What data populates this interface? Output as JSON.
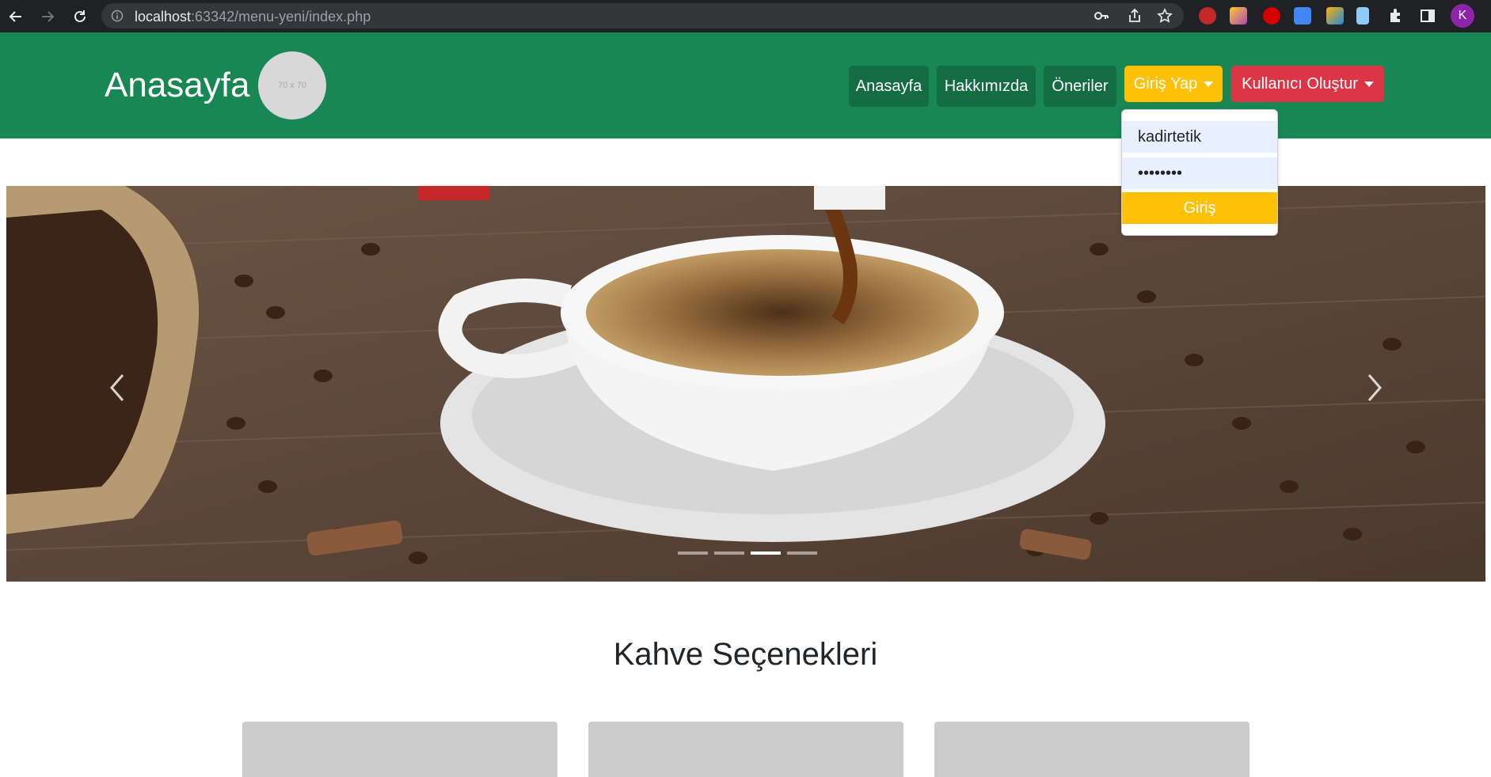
{
  "browser": {
    "url_host": "localhost",
    "url_path": ":63342/menu-yeni/index.php",
    "profile_initial": "K"
  },
  "header": {
    "brand": "Anasayfa",
    "logo_placeholder": "70 x 70",
    "nav": [
      "Anasayfa",
      "Hakkımızda",
      "Öneriler"
    ],
    "login_dropdown": "Giriş Yap",
    "register_dropdown": "Kullanıcı Oluştur"
  },
  "login_form": {
    "username_value": "kadirtetik",
    "password_value": "••••••••",
    "submit_label": "Giriş"
  },
  "carousel": {
    "slide_count": 4,
    "active_slide": 3,
    "prev_icon": "chevron-left-icon",
    "next_icon": "chevron-right-icon"
  },
  "section": {
    "title": "Kahve Seçenekleri",
    "card_count": 3
  },
  "colors": {
    "header_green": "#198754",
    "nav_button": "#146c43",
    "warning": "#ffc107",
    "danger": "#dc3545",
    "card_placeholder": "#cccccc"
  }
}
